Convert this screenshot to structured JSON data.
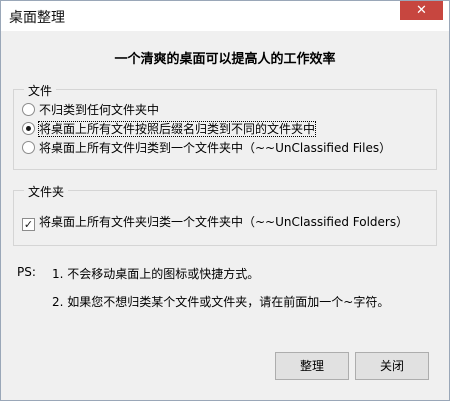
{
  "window": {
    "title": "桌面整理",
    "close_glyph": "✕"
  },
  "headline": "一个清爽的桌面可以提高人的工作效率",
  "files_group": {
    "title": "文件",
    "options": [
      {
        "label": "不归类到任何文件夹中",
        "checked": false
      },
      {
        "label": "将桌面上所有文件按照后缀名归类到不同的文件夹中",
        "checked": true
      },
      {
        "label": "将桌面上所有文件归类到一个文件夹中（~~UnClassified Files）",
        "checked": false
      }
    ]
  },
  "folders_group": {
    "title": "文件夹",
    "checkbox": {
      "label": "将桌面上所有文件夹归类一个文件夹中（~~UnClassified Folders）",
      "checked": true,
      "glyph": "✓"
    }
  },
  "ps": {
    "label": "PS:",
    "lines": [
      "1. 不会移动桌面上的图标或快捷方式。",
      "2. 如果您不想归类某个文件或文件夹，请在前面加一个~字符。"
    ]
  },
  "buttons": {
    "organize": "整理",
    "close": "关闭"
  }
}
